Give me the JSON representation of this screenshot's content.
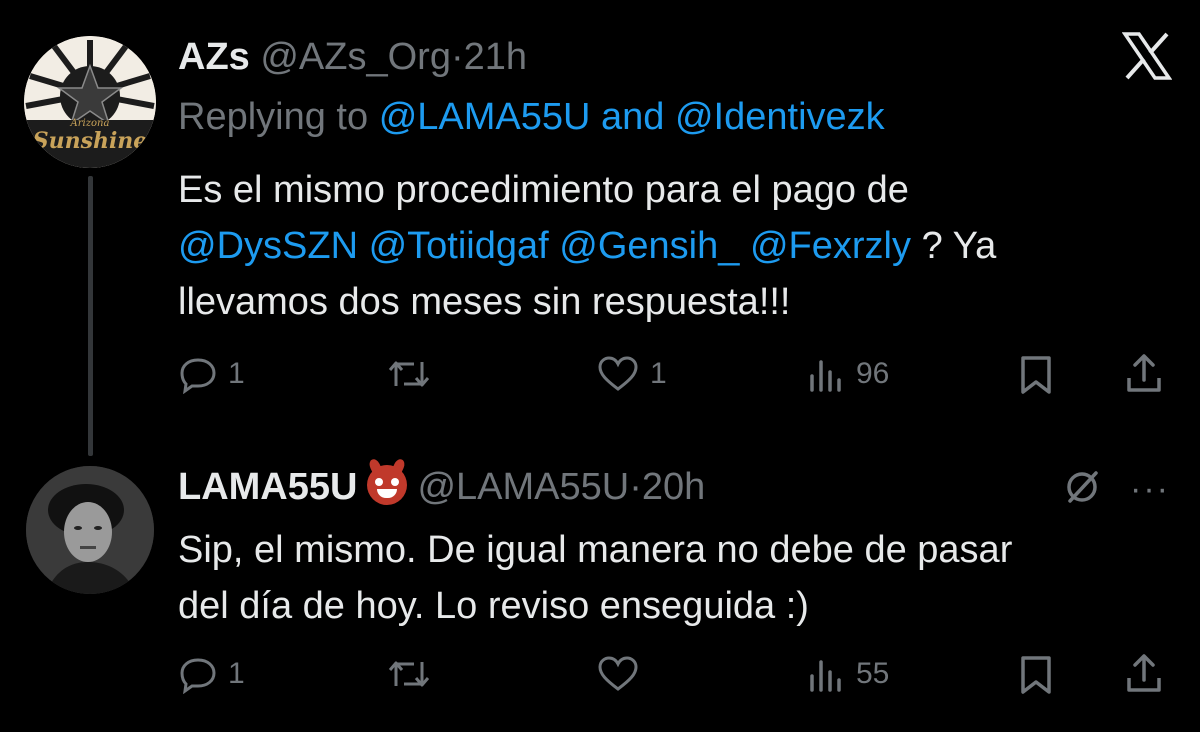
{
  "tweets": [
    {
      "name": "AZs",
      "handle": "@AZs_Org",
      "dot": "·",
      "time": "21h",
      "avatar_text_small": "Arizona",
      "avatar_text": "Sunshine",
      "replying_prefix": "Replying to",
      "replying_to": [
        "@LAMA55U",
        "@Identivezk"
      ],
      "replying_and": "and",
      "text_line1": "Es el mismo procedimiento para el pago de",
      "mentions": [
        "@DysSZN",
        "@Totiidgaf",
        "@Gensih_",
        "@Fexrzly"
      ],
      "text_after_mentions": "? Ya",
      "text_line3": "llevamos dos meses sin respuesta!!!",
      "replies": "1",
      "reposts": "",
      "likes": "1",
      "views": "96"
    },
    {
      "name": "LAMA55U",
      "handle": "@LAMA55U",
      "dot": "·",
      "time": "20h",
      "text_line1": "Sip, el mismo. De igual manera no debe de pasar",
      "text_line2": "del día de hoy. Lo reviso enseguida :)",
      "replies": "1",
      "reposts": "",
      "likes": "",
      "views": "55",
      "more": "···"
    }
  ],
  "icons": {
    "close": "x-logo-icon",
    "reply": "reply-icon",
    "repost": "repost-icon",
    "like": "heart-icon",
    "views": "views-icon",
    "bookmark": "bookmark-icon",
    "share": "share-icon"
  },
  "colors": {
    "background": "#000000",
    "text": "#e7e9ea",
    "muted": "#71767b",
    "link": "#1d9bf0"
  }
}
